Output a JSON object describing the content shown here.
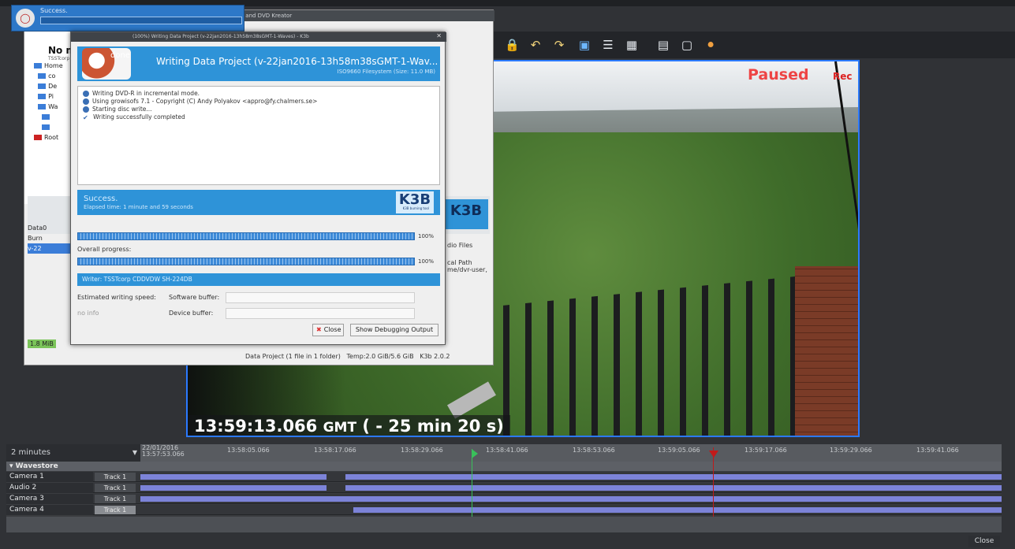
{
  "k3b_window": {
    "title": "ne CD and DVD Kreator",
    "project_name": "No m",
    "project_sub": "TSSTcorp",
    "tree": [
      "Home",
      "co",
      "De",
      "Pi",
      "Wa",
      "",
      "",
      "Root"
    ],
    "projects": [
      "Data0",
      "Burn",
      "v-22"
    ],
    "size_left": "1.8 MiB",
    "files_tab": "dio Files",
    "path_header": "cal Path",
    "path_value": "me/dvr-user,",
    "status": "Data Project (1 file in 1 folder)",
    "temp": "Temp:2.0 GiB/5.6 GiB",
    "version": "K3b 2.0.2",
    "logo": "K3B"
  },
  "notification": {
    "title": "Success."
  },
  "dialog": {
    "titlebar": "(100%) Writing Data Project (v-22jan2016-13h58m38sGMT-1-Waves) - K3b",
    "done": "done",
    "header_title": "Writing Data Project (v-22jan2016-13h58m38sGMT-1-Wav...",
    "header_sub": "ISO9660 Filesystem (Size: 11.0 MB)",
    "log": [
      "Writing DVD-R in incremental mode.",
      "Using growisofs 7.1 - Copyright (C) Andy Polyakov <appro@fy.chalmers.se>",
      "Starting disc write...",
      "Writing successfully completed"
    ],
    "success_title": "Success.",
    "success_sub": "Elapsed time: 1 minute and 59 seconds",
    "k3b_logo": "K3B",
    "k3b_logo_sub": "K3B burning tool",
    "progress_pct": "100%",
    "overall_label": "Overall progress:",
    "overall_pct": "100%",
    "writer": "Writer: TSSTcorp CDDVDW SH-224DB",
    "speed_label": "Estimated writing speed:",
    "speed_value": "no info",
    "sw_buffer_label": "Software buffer:",
    "dev_buffer_label": "Device buffer:",
    "close_label": "Close",
    "debug_label": "Show Debugging Output"
  },
  "video": {
    "paused": "Paused",
    "rec": "Rec",
    "timecode": "13:59:13.066",
    "gmt": "GMT",
    "offset": "( - 25 min 20 s)"
  },
  "timeline": {
    "zoom": "2 minutes",
    "ticks": [
      "22/01/2016 13:57:53.066",
      "13:58:05.066",
      "13:58:17.066",
      "13:58:29.066",
      "13:58:41.066",
      "13:58:53.066",
      "13:59:05.066",
      "13:59:17.066",
      "13:59:29.066",
      "13:59:41.066"
    ],
    "group": "Wavestore",
    "rows": [
      {
        "name": "Camera 1",
        "track": "Track 1"
      },
      {
        "name": "Audio 2",
        "track": "Track 1"
      },
      {
        "name": "Camera 3",
        "track": "Track 1"
      },
      {
        "name": "Camera 4",
        "track": "Track 1"
      }
    ],
    "close": "Close"
  }
}
